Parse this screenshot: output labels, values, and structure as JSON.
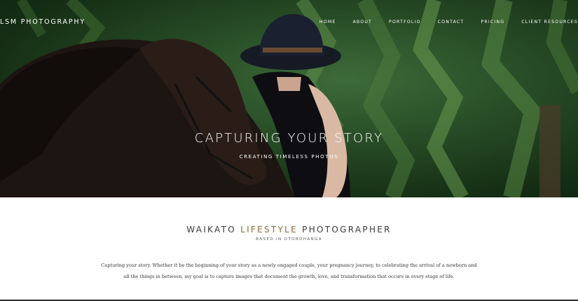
{
  "site": {
    "brand": "LSM PHOTOGRAPHY"
  },
  "nav": {
    "items": [
      "HOME",
      "ABOUT",
      "PORTFOLIO",
      "CONTACT",
      "PRICING",
      "CLIENT RESOURCES"
    ]
  },
  "hero": {
    "title": "CAPTURING YOUR STORY",
    "subtitle": "CREATING TIMELESS PHOTOS"
  },
  "intro": {
    "title_main": "WAIKATO ",
    "title_accent": "LIFESTYLE",
    "title_end": " PHOTOGRAPHER",
    "location": "BASED IN OTOROHANGA",
    "body": "Capturing your story. Whether it be the beginning of your story as a newly engaged couple, your pregnancy journey, to celebrating the arrival of a newborn and all the things in between, my goal is to capture images that document the growth, love, and transformation that occurs in every stage of life."
  },
  "colors": {
    "accent": "#8a6d3b",
    "text_dark": "#3a3a3a",
    "foliage": "#264a24"
  }
}
